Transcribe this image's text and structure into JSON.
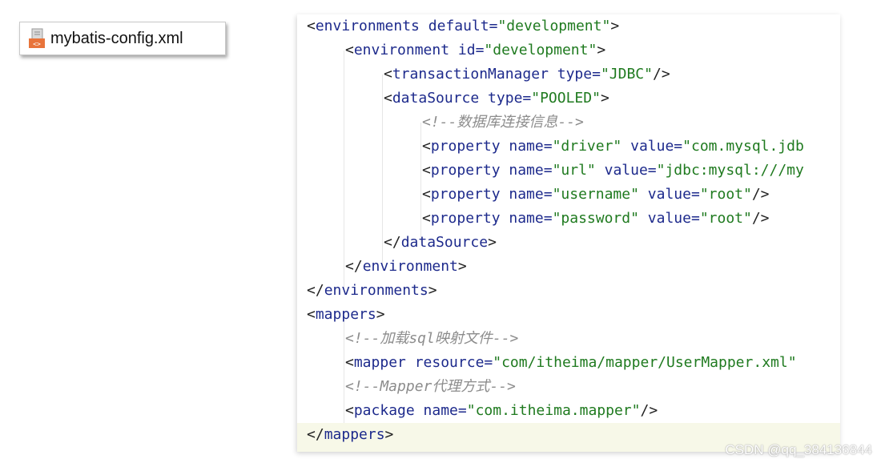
{
  "file_tab": {
    "filename": "mybatis-config.xml",
    "icon": "xml-file-icon"
  },
  "code_lines": [
    [
      "<",
      "environments",
      " default=",
      "\"development\"",
      ">"
    ],
    [
      "<",
      "environment",
      " id=",
      "\"development\"",
      ">"
    ],
    [
      "<",
      "transactionManager",
      " type=",
      "\"JDBC\"",
      "/>"
    ],
    [
      "<",
      "dataSource",
      " type=",
      "\"POOLED\"",
      ">"
    ],
    [
      "<!--数据库连接信息-->"
    ],
    [
      "<",
      "property",
      " name=",
      "\"driver\"",
      " value=",
      "\"com.mysql.jdb"
    ],
    [
      "<",
      "property",
      " name=",
      "\"url\"",
      " value=",
      "\"jdbc:mysql:///my"
    ],
    [
      "<",
      "property",
      " name=",
      "\"username\"",
      " value=",
      "\"root\"",
      "/>"
    ],
    [
      "<",
      "property",
      " name=",
      "\"password\"",
      " value=",
      "\"root\"",
      "/>"
    ],
    [
      "</",
      "dataSource",
      ">"
    ],
    [
      "</",
      "environment",
      ">"
    ],
    [
      "</",
      "environments",
      ">"
    ],
    [
      "<",
      "mappers",
      ">"
    ],
    [
      "<!--加载sql映射文件-->"
    ],
    [
      "<",
      "mapper",
      " resource=",
      "\"com/itheima/mapper/UserMapper.xml\""
    ],
    [
      "<!--Mapper代理方式-->"
    ],
    [
      "<",
      "package",
      " name=",
      "\"com.itheima.mapper\"",
      "/>"
    ],
    [
      "</",
      "mappers",
      ">"
    ]
  ],
  "watermark": "CSDN @qq_384136844",
  "colors": {
    "tag": "#1d2a8c",
    "attr_value": "#1f7a1f",
    "comment": "#8c8c8c",
    "last_line_highlight": "#f7f8e8"
  }
}
